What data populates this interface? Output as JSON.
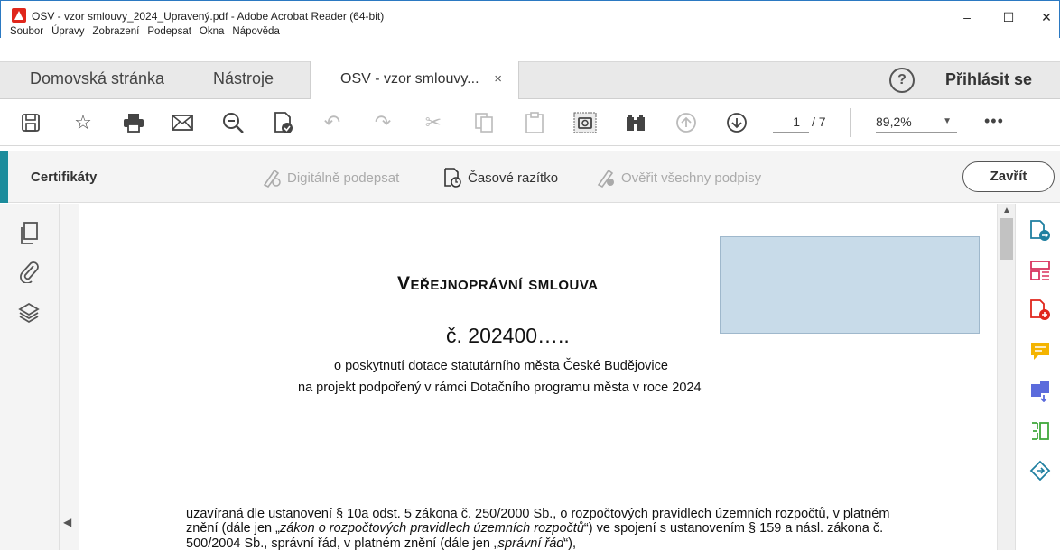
{
  "window": {
    "title": "OSV - vzor smlouvy_2024_Upravený.pdf - Adobe Acrobat Reader (64-bit)",
    "minimize": "–",
    "maximize": "☐",
    "close": "✕"
  },
  "menu": [
    "Soubor",
    "Úpravy",
    "Zobrazení",
    "Podepsat",
    "Okna",
    "Nápověda"
  ],
  "tabs": {
    "home": "Domovská stránka",
    "tools": "Nástroje",
    "document": "OSV - vzor smlouvy...",
    "document_close": "×",
    "help": "?",
    "signin": "Přihlásit se"
  },
  "toolbar": {
    "page_current": "1",
    "page_total": "/ 7",
    "zoom": "89,2%",
    "more": "•••",
    "icons": [
      "save-icon",
      "bookmark-star-icon",
      "print-icon",
      "email-icon",
      "zoom-search-icon",
      "edit-sign-icon",
      "undo-icon",
      "redo-icon",
      "cut-icon",
      "copy-icon",
      "paste-icon",
      "snapshot-icon",
      "find-binoculars-icon",
      "page-up-icon",
      "page-down-icon"
    ]
  },
  "certificates": {
    "title": "Certifikáty",
    "digital_sign": "Digitálně podepsat",
    "timestamp": "Časové razítko",
    "validate_all": "Ověřit všechny podpisy",
    "close": "Zavřít"
  },
  "document": {
    "heading": "Veřejnoprávní smlouva",
    "number": "č. 202400…..",
    "subtitle1": "o poskytnutí dotace statutárního města České Budějovice",
    "subtitle2": "na projekt podpořený v rámci Dotačního programu města v roce 2024",
    "para_a": "uzavíraná dle ustanovení § 10a odst. 5 zákona č. 250/2000 Sb., o rozpočtových pravidlech územních rozpočtů, v platném znění (dále jen „",
    "para_b": "zákon o rozpočtových pravidlech územních rozpočtů",
    "para_c": "“) ve spojení s ustanovením § 159 a násl. zákona č. 500/2004 Sb., správní řád, v platném znění (dále jen „",
    "para_d": "správní řád",
    "para_e": "“),"
  },
  "colors": {
    "accent": "#1c8c9c",
    "form_field": "#c8dbe9",
    "acrobat_red": "#e0261b"
  }
}
